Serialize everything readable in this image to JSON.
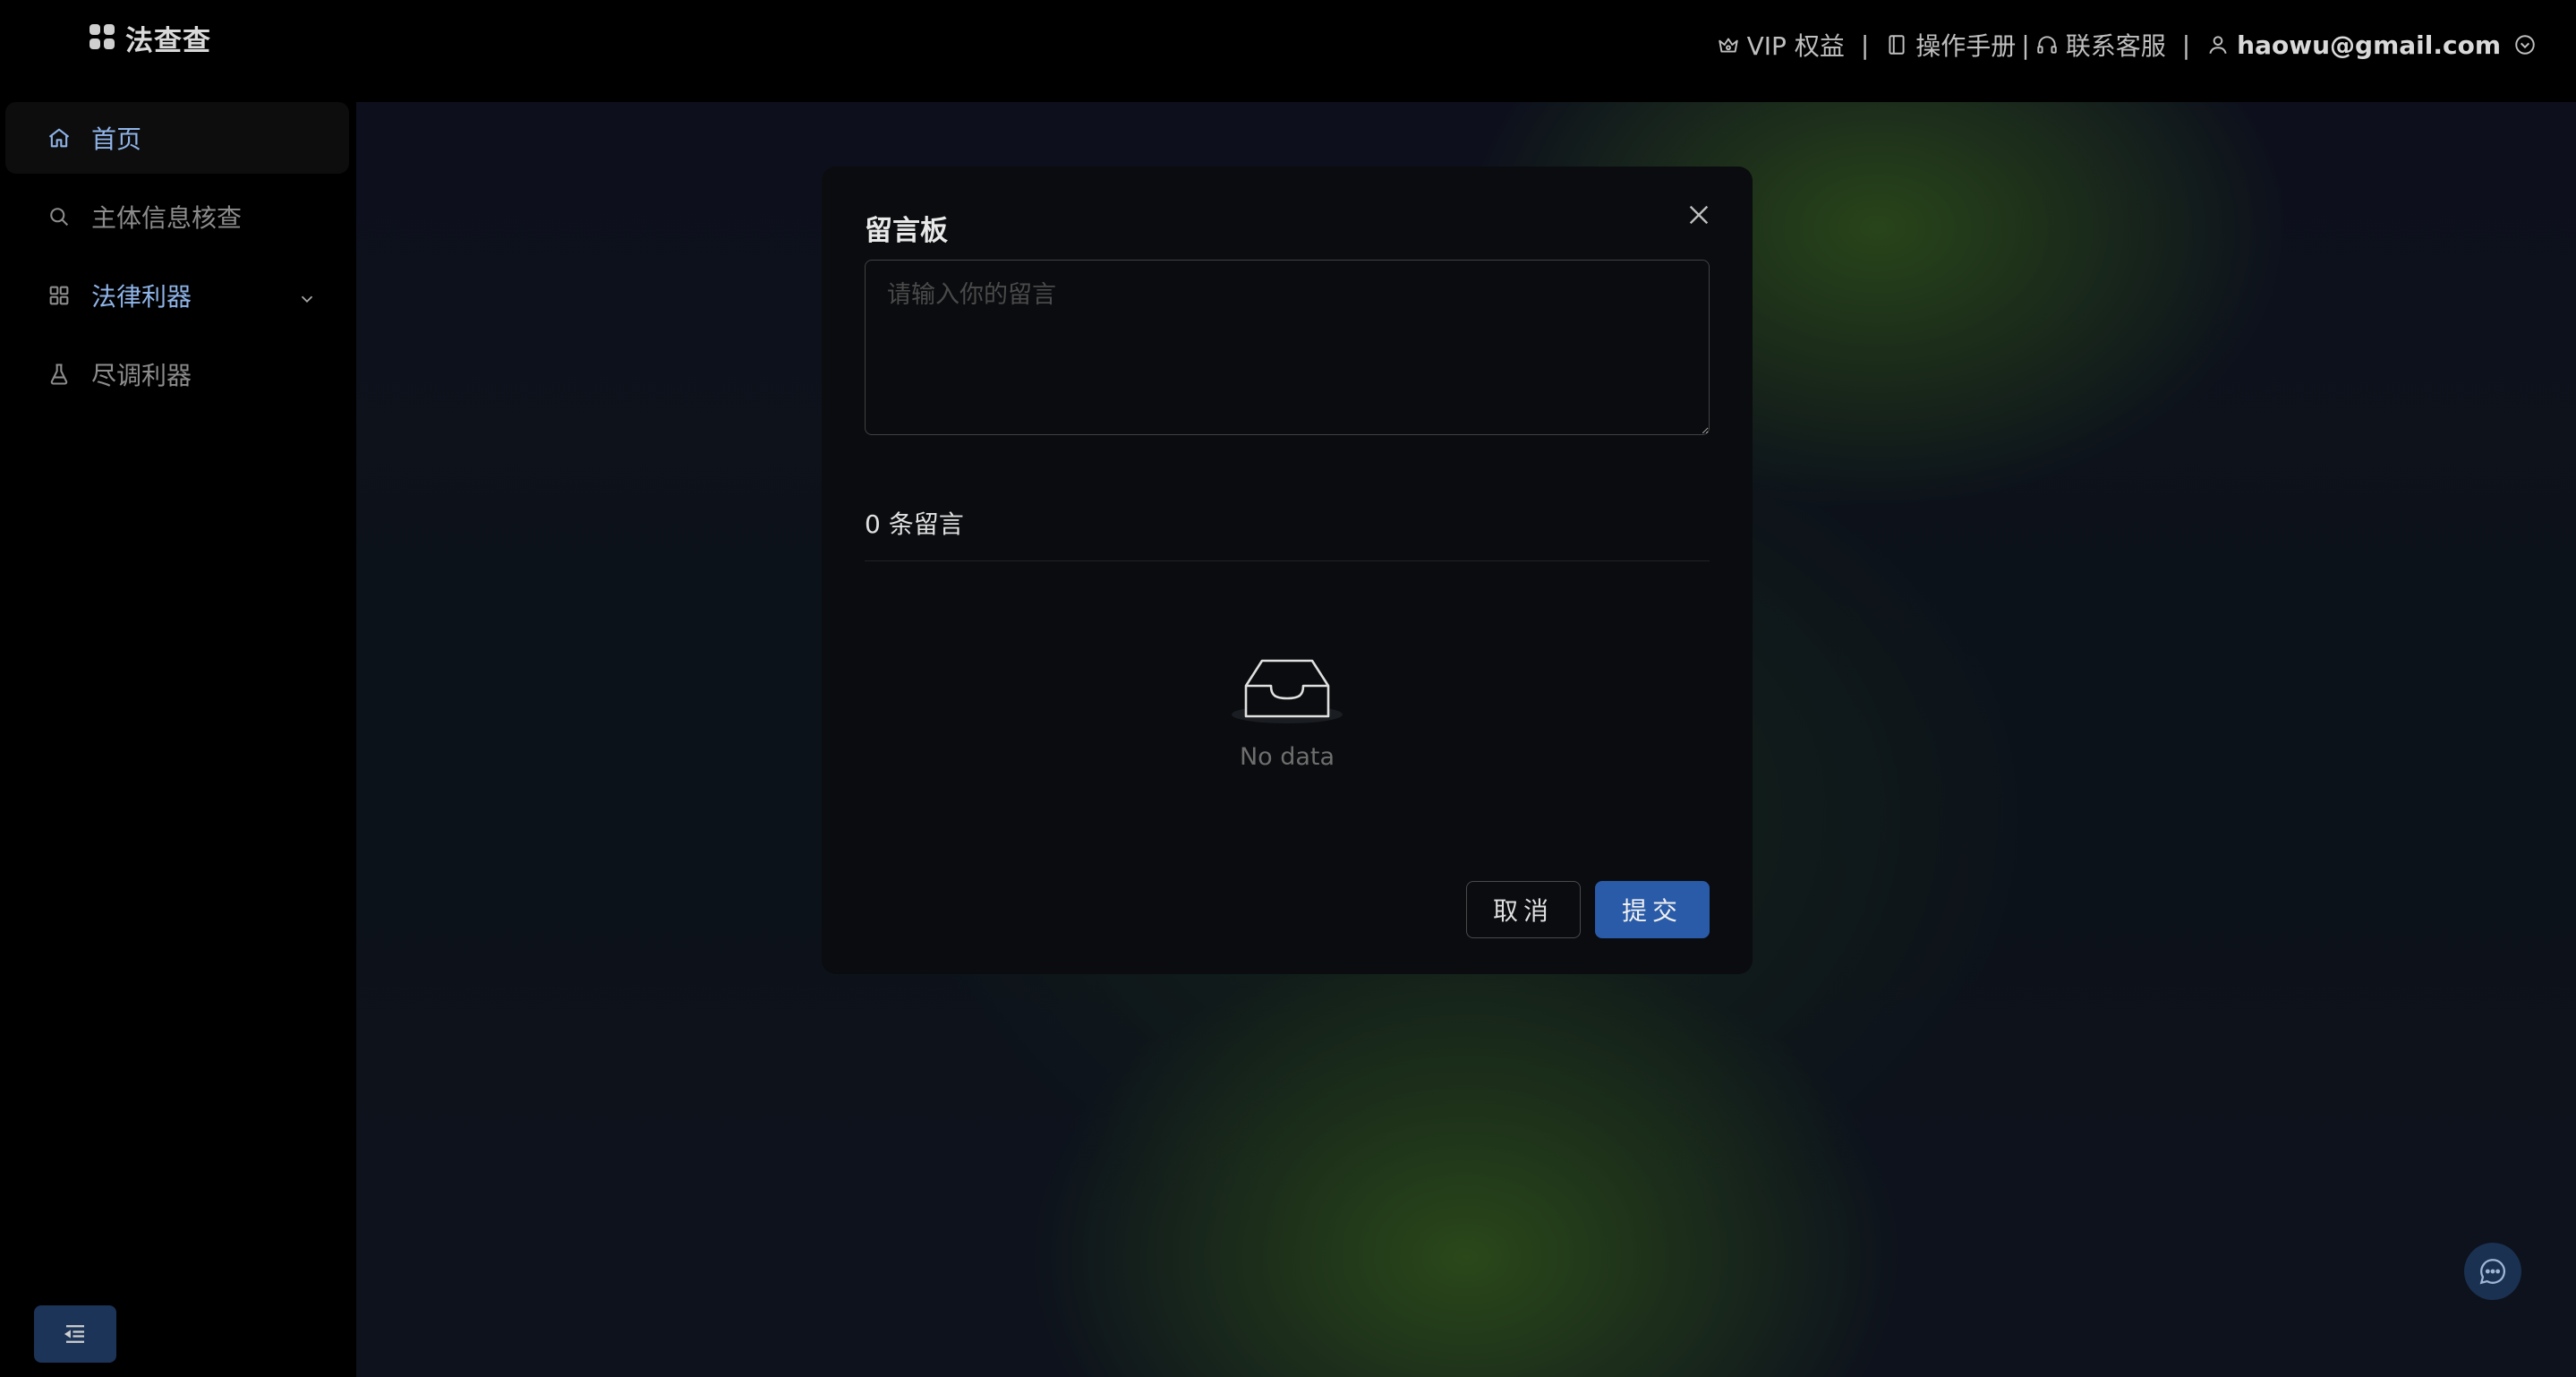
{
  "app": {
    "title": "法查查"
  },
  "header": {
    "vip_label": "VIP 权益",
    "manual_label": "操作手册",
    "support_label": "联系客服",
    "separator": "|",
    "user_email": "haowu@gmail.com"
  },
  "sidebar": {
    "items": [
      {
        "label": "首页",
        "icon": "home-icon",
        "active": true
      },
      {
        "label": "主体信息核查",
        "icon": "search-icon"
      },
      {
        "label": "法律利器",
        "icon": "apps-icon",
        "expandable": true
      },
      {
        "label": "尽调利器",
        "icon": "flask-icon"
      }
    ]
  },
  "modal": {
    "title": "留言板",
    "textarea_placeholder": "请输入你的留言",
    "textarea_value": "",
    "count_label": "0 条留言",
    "empty_text": "No data",
    "cancel_label": "取消",
    "submit_label": "提交"
  },
  "colors": {
    "accent": "#2a5ba8",
    "active_nav_text": "#8fb4e8",
    "background": "#000000"
  }
}
